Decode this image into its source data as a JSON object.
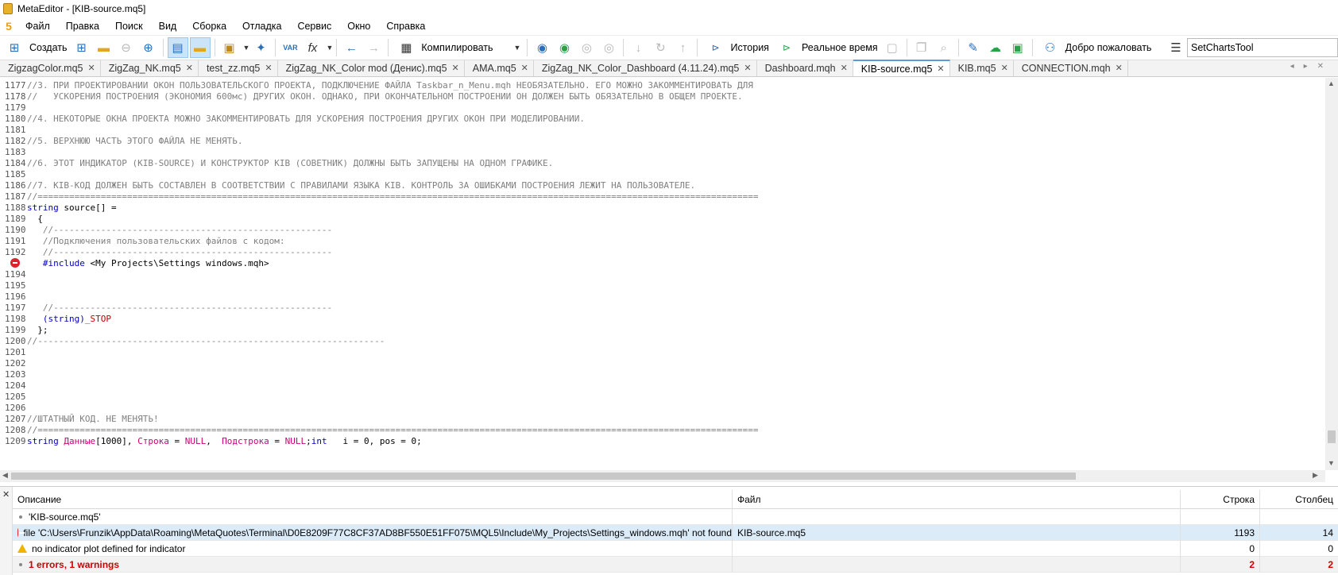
{
  "window": {
    "title": "MetaEditor - [KIB-source.mq5]",
    "app_icon_glyph": "5"
  },
  "menu": [
    "Файл",
    "Правка",
    "Поиск",
    "Вид",
    "Сборка",
    "Отладка",
    "Сервис",
    "Окно",
    "Справка"
  ],
  "toolbar": {
    "create_label": "Создать",
    "compile_label": "Компилировать",
    "history_label": "История",
    "realtime_label": "Реальное время",
    "welcome_label": "Добро пожаловать",
    "charts_tool_value": "SetChartsTool",
    "var_glyph": "VAR",
    "fx_glyph": "fx"
  },
  "tabs": [
    {
      "label": "ZigzagColor.mq5",
      "active": false
    },
    {
      "label": "ZigZag_NK.mq5",
      "active": false
    },
    {
      "label": "test_zz.mq5",
      "active": false
    },
    {
      "label": "ZigZag_NK_Color mod (Денис).mq5",
      "active": false
    },
    {
      "label": "AMA.mq5",
      "active": false
    },
    {
      "label": "ZigZag_NK_Color_Dashboard (4.11.24).mq5",
      "active": false
    },
    {
      "label": "Dashboard.mqh",
      "active": false
    },
    {
      "label": "KIB-source.mq5",
      "active": true
    },
    {
      "label": "KIB.mq5",
      "active": false
    },
    {
      "label": "CONNECTION.mqh",
      "active": false
    }
  ],
  "code": [
    {
      "n": "1177",
      "parts": [
        {
          "c": "cm",
          "t": "//3. ПРИ ПРОЕКТИРОВАНИИ ОКОН ПОЛЬЗОВАТЕЛЬСКОГО ПРОЕКТА, ПОДКЛЮЧЕНИЕ ФАЙЛА Taskbar_n_Menu.mqh НЕОБЯЗАТЕЛЬНО. ЕГО МОЖНО ЗАКОММЕНТИРОВАТЬ ДЛЯ"
        }
      ]
    },
    {
      "n": "1178",
      "parts": [
        {
          "c": "cm",
          "t": "//   УСКОРЕНИЯ ПОСТРОЕНИЯ (ЭКОНОМИЯ 600мс) ДРУГИХ ОКОН. ОДНАКО, ПРИ ОКОНЧАТЕЛЬНОМ ПОСТРОЕНИИ ОН ДОЛЖЕН БЫТЬ ОБЯЗАТЕЛЬНО В ОБЩЕМ ПРОЕКТЕ."
        }
      ]
    },
    {
      "n": "1179",
      "parts": []
    },
    {
      "n": "1180",
      "parts": [
        {
          "c": "cm",
          "t": "//4. НЕКОТОРЫЕ ОКНА ПРОЕКТА МОЖНО ЗАКОММЕНТИРОВАТЬ ДЛЯ УСКОРЕНИЯ ПОСТРОЕНИЯ ДРУГИХ ОКОН ПРИ МОДЕЛИРОВАНИИ."
        }
      ]
    },
    {
      "n": "1181",
      "parts": []
    },
    {
      "n": "1182",
      "parts": [
        {
          "c": "cm",
          "t": "//5. ВЕРХНЮЮ ЧАСТЬ ЭТОГО ФАЙЛА НЕ МЕНЯТЬ."
        }
      ]
    },
    {
      "n": "1183",
      "parts": []
    },
    {
      "n": "1184",
      "parts": [
        {
          "c": "cm",
          "t": "//6. ЭТОТ ИНДИКАТОР (KIB-SOURCE) И КОНСТРУКТОР KIB (СОВЕТНИК) ДОЛЖНЫ БЫТЬ ЗАПУЩЕНЫ НА ОДНОМ ГРАФИКЕ."
        }
      ]
    },
    {
      "n": "1185",
      "parts": []
    },
    {
      "n": "1186",
      "parts": [
        {
          "c": "cm",
          "t": "//7. KIB-КОД ДОЛЖЕН БЫТЬ СОСТАВЛЕН В СООТВЕТСТВИИ С ПРАВИЛАМИ ЯЗЫКА KIB. КОНТРОЛЬ ЗА ОШИБКАМИ ПОСТРОЕНИЯ ЛЕЖИТ НА ПОЛЬЗОВАТЕЛЕ."
        }
      ]
    },
    {
      "n": "1187",
      "parts": [
        {
          "c": "cm",
          "t": "//========================================================================================================================================="
        }
      ]
    },
    {
      "n": "1188",
      "parts": [
        {
          "c": "kw",
          "t": "string"
        },
        {
          "c": "",
          "t": " source[] ="
        }
      ]
    },
    {
      "n": "1189",
      "parts": [
        {
          "c": "",
          "t": "  {"
        }
      ]
    },
    {
      "n": "1190",
      "parts": [
        {
          "c": "cm",
          "t": "   //-----------------------------------------------------"
        }
      ]
    },
    {
      "n": "1191",
      "parts": [
        {
          "c": "cm",
          "t": "   //Подключения пользовательских файлов с кодом:"
        }
      ]
    },
    {
      "n": "1192",
      "parts": [
        {
          "c": "cm",
          "t": "   //-----------------------------------------------------"
        }
      ]
    },
    {
      "n": "",
      "error": true,
      "parts": [
        {
          "c": "pp",
          "t": "   #include"
        },
        {
          "c": "",
          "t": " <My Projects\\Settings windows.mqh>"
        }
      ]
    },
    {
      "n": "1194",
      "parts": []
    },
    {
      "n": "1195",
      "parts": []
    },
    {
      "n": "1196",
      "parts": []
    },
    {
      "n": "1197",
      "parts": [
        {
          "c": "cm",
          "t": "   //-----------------------------------------------------"
        }
      ]
    },
    {
      "n": "1198",
      "parts": [
        {
          "c": "",
          "t": "   "
        },
        {
          "c": "kw",
          "t": "(string)"
        },
        {
          "c": "st",
          "t": "_STOP"
        }
      ]
    },
    {
      "n": "1199",
      "parts": [
        {
          "c": "",
          "t": "  };"
        }
      ]
    },
    {
      "n": "1200",
      "parts": [
        {
          "c": "cm",
          "t": "//------------------------------------------------------------------"
        }
      ]
    },
    {
      "n": "1201",
      "parts": []
    },
    {
      "n": "1202",
      "parts": []
    },
    {
      "n": "1203",
      "parts": []
    },
    {
      "n": "1204",
      "parts": []
    },
    {
      "n": "1205",
      "parts": []
    },
    {
      "n": "1206",
      "parts": []
    },
    {
      "n": "1207",
      "parts": [
        {
          "c": "cm",
          "t": "//ШТАТНЫЙ КОД. НЕ МЕНЯТЬ!"
        }
      ]
    },
    {
      "n": "1208",
      "parts": [
        {
          "c": "cm",
          "t": "//========================================================================================================================================="
        }
      ]
    },
    {
      "n": "1209",
      "parts": [
        {
          "c": "kw",
          "t": "string"
        },
        {
          "c": "",
          "t": " "
        },
        {
          "c": "nm",
          "t": "Данные"
        },
        {
          "c": "",
          "t": "[1000], "
        },
        {
          "c": "nm",
          "t": "Строка"
        },
        {
          "c": "",
          "t": " = "
        },
        {
          "c": "nm",
          "t": "NULL"
        },
        {
          "c": "",
          "t": ",  "
        },
        {
          "c": "nm",
          "t": "Подстрока"
        },
        {
          "c": "",
          "t": " = "
        },
        {
          "c": "nm",
          "t": "NULL"
        },
        {
          "c": "",
          "t": ";"
        },
        {
          "c": "kw",
          "t": "int"
        },
        {
          "c": "",
          "t": "   i = 0, pos = 0;"
        }
      ]
    }
  ],
  "errors_panel": {
    "headers": {
      "description": "Описание",
      "file": "Файл",
      "line": "Строка",
      "column": "Столбец"
    },
    "rows": [
      {
        "icon": "dot",
        "description": "'KIB-source.mq5'",
        "file": "",
        "line": "",
        "column": ""
      },
      {
        "icon": "error",
        "selected": true,
        "description": "file 'C:\\Users\\Frunzik\\AppData\\Roaming\\MetaQuotes\\Terminal\\D0E8209F77C8CF37AD8BF550E51FF075\\MQL5\\Include\\My_Projects\\Settings_windows.mqh' not found",
        "file": "KIB-source.mq5",
        "line": "1193",
        "column": "14"
      },
      {
        "icon": "warning",
        "description": "no indicator plot defined for indicator",
        "file": "",
        "line": "0",
        "column": "0"
      },
      {
        "icon": "dot",
        "summary": true,
        "description": "1 errors, 1 warnings",
        "file": "",
        "line": "2",
        "column": "2"
      }
    ]
  },
  "colors": {
    "accent": "#5a9bd8",
    "error": "#d9252a",
    "warning": "#f0b400",
    "selection": "#dcebf8"
  }
}
